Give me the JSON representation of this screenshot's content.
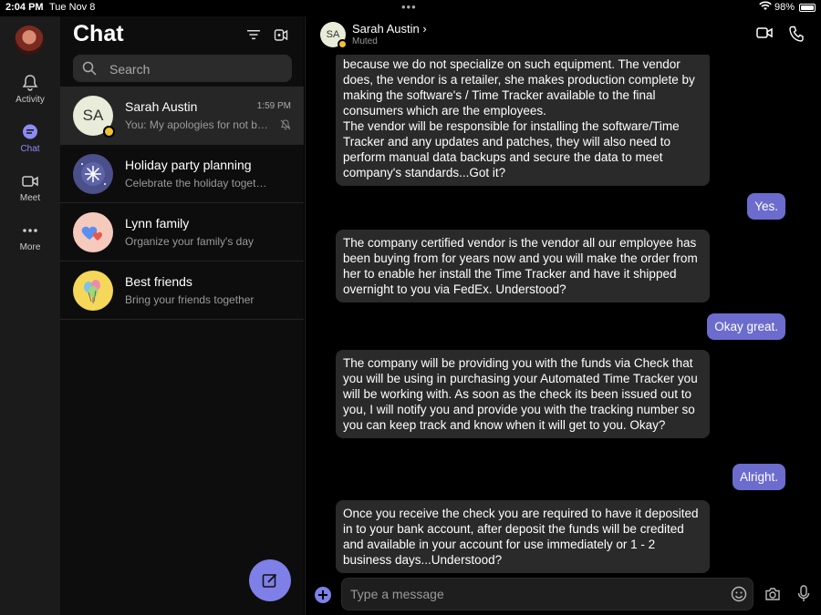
{
  "status_bar": {
    "time": "2:04 PM",
    "date": "Tue Nov 8",
    "battery": "98%"
  },
  "nav": {
    "items": [
      {
        "label": "Activity",
        "icon": "bell-icon"
      },
      {
        "label": "Chat",
        "icon": "chat-icon",
        "active": true
      },
      {
        "label": "Meet",
        "icon": "video-icon"
      },
      {
        "label": "More",
        "icon": "ellipsis-icon"
      }
    ]
  },
  "chat_list": {
    "title": "Chat",
    "search_placeholder": "Search",
    "chats": [
      {
        "name": "Sarah Austin",
        "initials": "SA",
        "preview": "You: My apologies for not being",
        "time": "1:59 PM",
        "muted": true,
        "active": true
      },
      {
        "name": "Holiday party planning",
        "preview": "Celebrate the holiday together",
        "time": ""
      },
      {
        "name": "Lynn family",
        "preview": "Organize your family's day",
        "time": ""
      },
      {
        "name": "Best friends",
        "preview": "Bring your friends together",
        "time": ""
      }
    ]
  },
  "conversation": {
    "name": "Sarah Austin",
    "initials": "SA",
    "status": "Muted",
    "messages": [
      {
        "dir": "in",
        "text": "because we do not specialize on such equipment. The vendor does, the vendor is a retailer, she makes production complete by making the software's / Time Tracker available to the final consumers which are the employees.\nThe vendor will be responsible for installing the software/Time Tracker and any updates and patches, they will also need to perform manual data backups and secure the data to meet company's standards...Got it?"
      },
      {
        "dir": "out",
        "text": "Yes."
      },
      {
        "dir": "in",
        "text": "The company certified vendor is the vendor all our employee has been buying from for years now and you will make the order from her to enable her install the Time Tracker and have it shipped overnight to you via FedEx. Understood?"
      },
      {
        "dir": "out",
        "text": "Okay great."
      },
      {
        "dir": "in",
        "text": "The company will be providing you with the funds via Check  that you will be using in purchasing your Automated Time Tracker you will be working with. As soon as the check its been issued out to you, I will notify you and provide you with the tracking number so you can keep track and know when it will get to you. Okay?"
      },
      {
        "dir": "out",
        "text": "Alright."
      },
      {
        "dir": "in",
        "text": "Once you receive the check you are required to have it deposited in to your bank account, after deposit the funds will be credited and available in your account for use immediately or 1 - 2 business days...Understood?"
      }
    ],
    "composer_placeholder": "Type a message"
  },
  "colors": {
    "accent": "#7f7fe8",
    "outgoing_bubble": "#6c6ccf",
    "incoming_bubble": "#2a2a2a",
    "away_badge": "#f1c230"
  }
}
